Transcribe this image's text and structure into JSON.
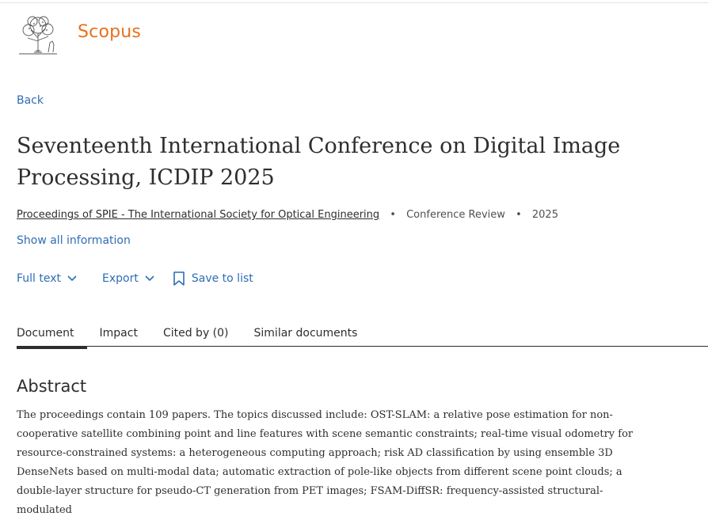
{
  "header": {
    "brand": "Scopus",
    "logo_icon": "elsevier-tree-icon",
    "brand_color": "#e9711c"
  },
  "nav": {
    "back_label": "Back"
  },
  "document": {
    "title": "Seventeenth International Conference on Digital Image Processing, ICDIP 2025",
    "source": "Proceedings of SPIE - The International Society for Optical Engineering",
    "doc_type": "Conference Review",
    "year": "2025",
    "show_all_label": "Show all information"
  },
  "actions": {
    "full_text_label": "Full text",
    "export_label": "Export",
    "save_label": "Save to list",
    "link_color": "#2e6db4"
  },
  "tabs": [
    {
      "label": "Document",
      "active": true
    },
    {
      "label": "Impact",
      "active": false
    },
    {
      "label": "Cited by (0)",
      "active": false
    },
    {
      "label": "Similar documents",
      "active": false
    }
  ],
  "abstract": {
    "heading": "Abstract",
    "text": "The proceedings contain 109 papers. The topics discussed include: OST-SLAM: a relative pose estimation for non-cooperative satellite combining point and line features with scene semantic constraints; real-time visual odometry for resource-constrained systems: a heterogeneous computing approach; risk AD classification by using ensemble 3D DenseNets based on multi-modal data; automatic extraction of pole-like objects from different scene point clouds; a double-layer structure for pseudo-CT generation from PET images; FSAM-DiffSR: frequency-assisted structural-modulated"
  }
}
